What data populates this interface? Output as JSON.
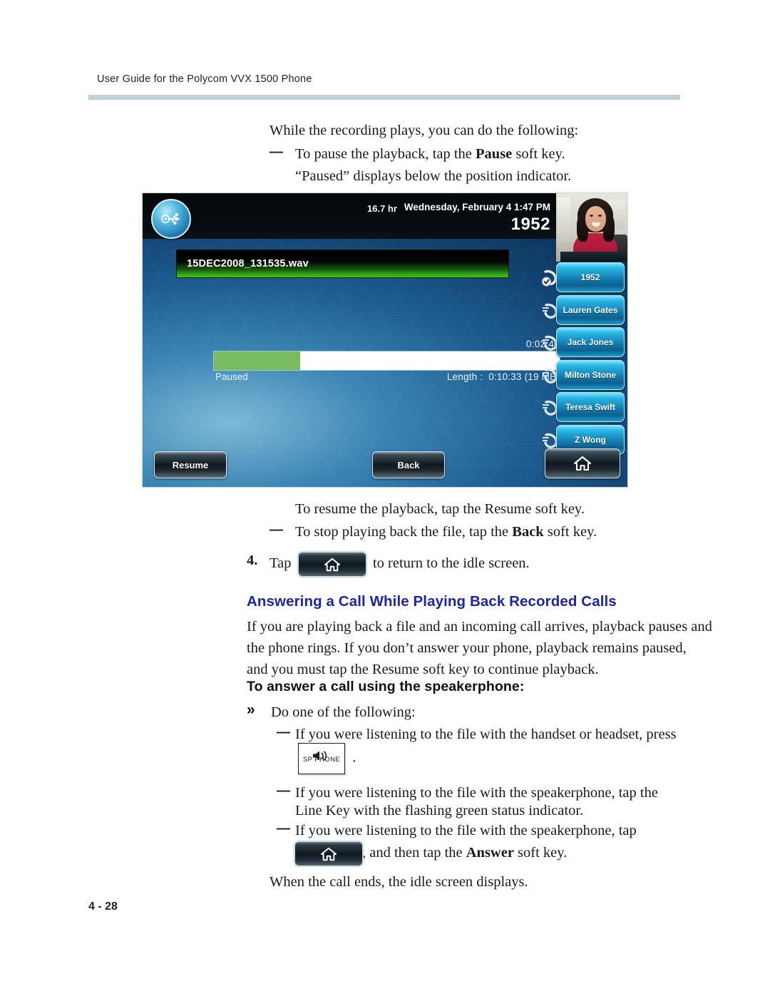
{
  "header": {
    "title": "User Guide for the Polycom VVX 1500 Phone"
  },
  "footer": {
    "page_number": "4 - 28"
  },
  "content": {
    "intro": "While the recording plays, you can do the following:",
    "bullet_pause_pre": "To pause the playback, tap the ",
    "bullet_pause_bold": "Pause",
    "bullet_pause_post": " soft key.",
    "paused_note": "“Paused” displays below the position indicator.",
    "resume_line": "To resume the playback, tap the Resume soft key.",
    "stop_pre": "To stop playing back the file, tap the ",
    "stop_bold": "Back",
    "stop_post": " soft key.",
    "step4_number": "4.",
    "step4_pre": "Tap",
    "step4_post": "to return to the idle screen.",
    "section_heading": "Answering a Call While Playing Back Recorded Calls",
    "section_body_line1": "If you are playing back a file and an incoming call arrives, playback pauses and",
    "section_body_line2": "the phone rings. If you don’t answer your phone, playback remains paused,",
    "section_body_line3": "and you must tap the Resume soft key to continue playback.",
    "sub_heading": "To answer a call using the speakerphone:",
    "chevron": "»",
    "do_one": "Do one of the following:",
    "opt1_line1": "If you were listening to the file with the handset or headset, press",
    "opt1_period": ".",
    "opt2_line1": "If you were listening to the file with the speakerphone, tap the",
    "opt2_line2": "Line Key with the flashing green status indicator.",
    "opt3_line1": "If you were listening to the file with the speakerphone, tap",
    "opt3_pre": ", and then tap the ",
    "opt3_bold": "Answer",
    "opt3_post": " soft key.",
    "closing": "When the call ends, the idle screen displays.",
    "dash": "—"
  },
  "sp_phone_key": {
    "label": "SP PHONE",
    "icon": "speaker-icon"
  },
  "phone_screen": {
    "status_bar": {
      "usb_icon": "usb-icon",
      "storage_remaining": "16.7 hr",
      "datetime": "Wednesday, February 4  1:47 PM",
      "extension": "1952"
    },
    "file_row": {
      "name": "15DEC2008_131535.wav"
    },
    "playback": {
      "position": "0:02:40",
      "status": "Paused",
      "length_label": "Length :",
      "length_value": "0:10:33 (19 MB)",
      "progress_percent": 25
    },
    "line_keys": [
      {
        "label": "1952",
        "icon": "handset-check-icon"
      },
      {
        "label": "Lauren Gates",
        "icon": "handset-icon"
      },
      {
        "label": "Jack Jones",
        "icon": "handset-icon"
      },
      {
        "label": "Milton Stone",
        "icon": "handset-icon"
      },
      {
        "label": "Teresa Swift",
        "icon": "handset-icon"
      },
      {
        "label": "Z Wong",
        "icon": "handset-icon"
      }
    ],
    "soft_keys": {
      "resume": "Resume",
      "back": "Back",
      "home_icon": "home-icon"
    }
  },
  "colors": {
    "heading_blue": "#1c24a8",
    "header_rule": "#bcd2d4",
    "progress_green": "#79bb5f",
    "line_key_cyan": "#2bb8e6"
  }
}
